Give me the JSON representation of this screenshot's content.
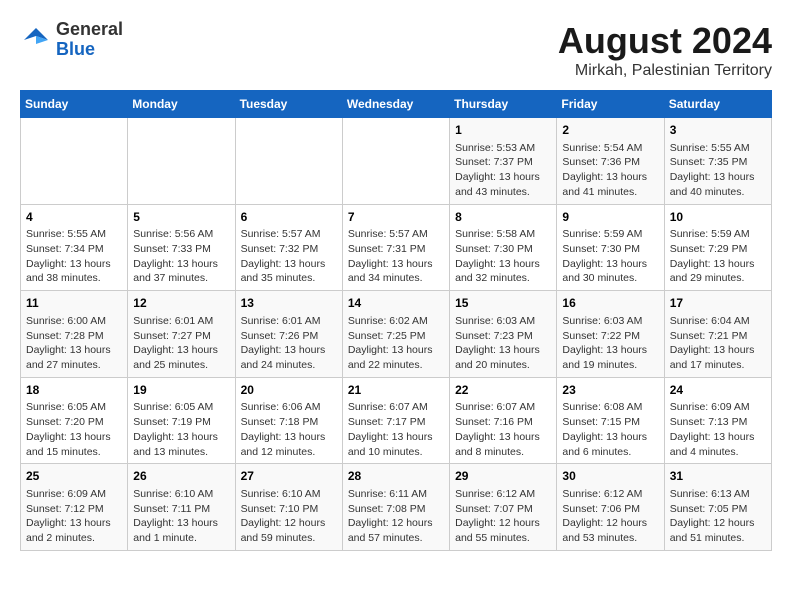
{
  "header": {
    "logo": {
      "general": "General",
      "blue": "Blue"
    },
    "title": "August 2024",
    "subtitle": "Mirkah, Palestinian Territory"
  },
  "weekdays": [
    "Sunday",
    "Monday",
    "Tuesday",
    "Wednesday",
    "Thursday",
    "Friday",
    "Saturday"
  ],
  "weeks": [
    [
      {
        "day": "",
        "info": ""
      },
      {
        "day": "",
        "info": ""
      },
      {
        "day": "",
        "info": ""
      },
      {
        "day": "",
        "info": ""
      },
      {
        "day": "1",
        "info": "Sunrise: 5:53 AM\nSunset: 7:37 PM\nDaylight: 13 hours\nand 43 minutes."
      },
      {
        "day": "2",
        "info": "Sunrise: 5:54 AM\nSunset: 7:36 PM\nDaylight: 13 hours\nand 41 minutes."
      },
      {
        "day": "3",
        "info": "Sunrise: 5:55 AM\nSunset: 7:35 PM\nDaylight: 13 hours\nand 40 minutes."
      }
    ],
    [
      {
        "day": "4",
        "info": "Sunrise: 5:55 AM\nSunset: 7:34 PM\nDaylight: 13 hours\nand 38 minutes."
      },
      {
        "day": "5",
        "info": "Sunrise: 5:56 AM\nSunset: 7:33 PM\nDaylight: 13 hours\nand 37 minutes."
      },
      {
        "day": "6",
        "info": "Sunrise: 5:57 AM\nSunset: 7:32 PM\nDaylight: 13 hours\nand 35 minutes."
      },
      {
        "day": "7",
        "info": "Sunrise: 5:57 AM\nSunset: 7:31 PM\nDaylight: 13 hours\nand 34 minutes."
      },
      {
        "day": "8",
        "info": "Sunrise: 5:58 AM\nSunset: 7:30 PM\nDaylight: 13 hours\nand 32 minutes."
      },
      {
        "day": "9",
        "info": "Sunrise: 5:59 AM\nSunset: 7:30 PM\nDaylight: 13 hours\nand 30 minutes."
      },
      {
        "day": "10",
        "info": "Sunrise: 5:59 AM\nSunset: 7:29 PM\nDaylight: 13 hours\nand 29 minutes."
      }
    ],
    [
      {
        "day": "11",
        "info": "Sunrise: 6:00 AM\nSunset: 7:28 PM\nDaylight: 13 hours\nand 27 minutes."
      },
      {
        "day": "12",
        "info": "Sunrise: 6:01 AM\nSunset: 7:27 PM\nDaylight: 13 hours\nand 25 minutes."
      },
      {
        "day": "13",
        "info": "Sunrise: 6:01 AM\nSunset: 7:26 PM\nDaylight: 13 hours\nand 24 minutes."
      },
      {
        "day": "14",
        "info": "Sunrise: 6:02 AM\nSunset: 7:25 PM\nDaylight: 13 hours\nand 22 minutes."
      },
      {
        "day": "15",
        "info": "Sunrise: 6:03 AM\nSunset: 7:23 PM\nDaylight: 13 hours\nand 20 minutes."
      },
      {
        "day": "16",
        "info": "Sunrise: 6:03 AM\nSunset: 7:22 PM\nDaylight: 13 hours\nand 19 minutes."
      },
      {
        "day": "17",
        "info": "Sunrise: 6:04 AM\nSunset: 7:21 PM\nDaylight: 13 hours\nand 17 minutes."
      }
    ],
    [
      {
        "day": "18",
        "info": "Sunrise: 6:05 AM\nSunset: 7:20 PM\nDaylight: 13 hours\nand 15 minutes."
      },
      {
        "day": "19",
        "info": "Sunrise: 6:05 AM\nSunset: 7:19 PM\nDaylight: 13 hours\nand 13 minutes."
      },
      {
        "day": "20",
        "info": "Sunrise: 6:06 AM\nSunset: 7:18 PM\nDaylight: 13 hours\nand 12 minutes."
      },
      {
        "day": "21",
        "info": "Sunrise: 6:07 AM\nSunset: 7:17 PM\nDaylight: 13 hours\nand 10 minutes."
      },
      {
        "day": "22",
        "info": "Sunrise: 6:07 AM\nSunset: 7:16 PM\nDaylight: 13 hours\nand 8 minutes."
      },
      {
        "day": "23",
        "info": "Sunrise: 6:08 AM\nSunset: 7:15 PM\nDaylight: 13 hours\nand 6 minutes."
      },
      {
        "day": "24",
        "info": "Sunrise: 6:09 AM\nSunset: 7:13 PM\nDaylight: 13 hours\nand 4 minutes."
      }
    ],
    [
      {
        "day": "25",
        "info": "Sunrise: 6:09 AM\nSunset: 7:12 PM\nDaylight: 13 hours\nand 2 minutes."
      },
      {
        "day": "26",
        "info": "Sunrise: 6:10 AM\nSunset: 7:11 PM\nDaylight: 13 hours\nand 1 minute."
      },
      {
        "day": "27",
        "info": "Sunrise: 6:10 AM\nSunset: 7:10 PM\nDaylight: 12 hours\nand 59 minutes."
      },
      {
        "day": "28",
        "info": "Sunrise: 6:11 AM\nSunset: 7:08 PM\nDaylight: 12 hours\nand 57 minutes."
      },
      {
        "day": "29",
        "info": "Sunrise: 6:12 AM\nSunset: 7:07 PM\nDaylight: 12 hours\nand 55 minutes."
      },
      {
        "day": "30",
        "info": "Sunrise: 6:12 AM\nSunset: 7:06 PM\nDaylight: 12 hours\nand 53 minutes."
      },
      {
        "day": "31",
        "info": "Sunrise: 6:13 AM\nSunset: 7:05 PM\nDaylight: 12 hours\nand 51 minutes."
      }
    ]
  ]
}
